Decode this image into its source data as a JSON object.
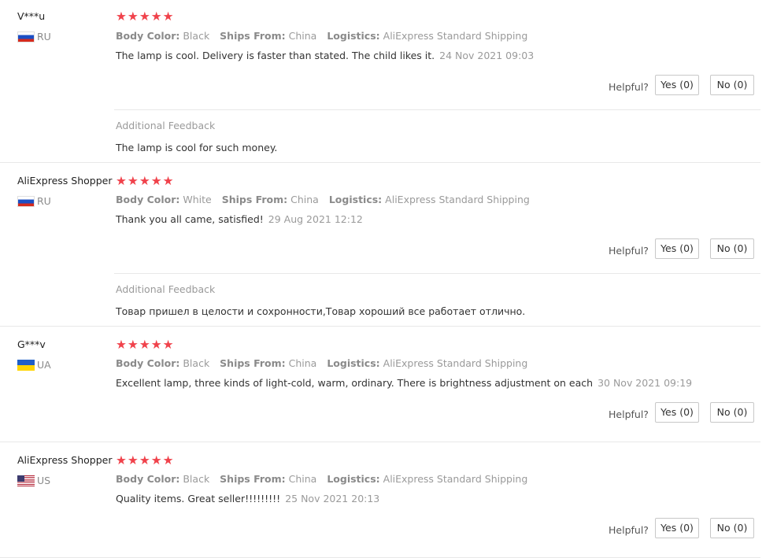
{
  "reviews": [
    {
      "user": "V***u",
      "country": "RU",
      "flag": "ru",
      "stars": 5,
      "attributes": {
        "color_label": "Body Color:",
        "color_value": "Black",
        "ships_label": "Ships From:",
        "ships_value": "China",
        "logistics_label": "Logistics:",
        "logistics_value": "AliExpress Standard Shipping"
      },
      "text": "The lamp is cool. Delivery is faster than stated. The child likes it.",
      "date": "24 Nov 2021 09:03",
      "helpful_label": "Helpful?",
      "yes_label": "Yes (0)",
      "no_label": "No (0)",
      "additional_feedback_title": "Additional Feedback",
      "additional_feedback_text": "The lamp is cool for such money."
    },
    {
      "user": "AliExpress Shopper",
      "country": "RU",
      "flag": "ru",
      "stars": 5,
      "attributes": {
        "color_label": "Body Color:",
        "color_value": "White",
        "ships_label": "Ships From:",
        "ships_value": "China",
        "logistics_label": "Logistics:",
        "logistics_value": "AliExpress Standard Shipping"
      },
      "text": "Thank you all came, satisfied!",
      "date": "29 Aug 2021 12:12",
      "helpful_label": "Helpful?",
      "yes_label": "Yes (0)",
      "no_label": "No (0)",
      "additional_feedback_title": "Additional Feedback",
      "additional_feedback_text": "Товар пришел в целости и сохронности,Товар хороший все работает отлично."
    },
    {
      "user": "G***v",
      "country": "UA",
      "flag": "ua",
      "stars": 5,
      "attributes": {
        "color_label": "Body Color:",
        "color_value": "Black",
        "ships_label": "Ships From:",
        "ships_value": "China",
        "logistics_label": "Logistics:",
        "logistics_value": "AliExpress Standard Shipping"
      },
      "text": "Excellent lamp, three kinds of light-cold, warm, ordinary. There is brightness adjustment on each",
      "date": "30 Nov 2021 09:19",
      "helpful_label": "Helpful?",
      "yes_label": "Yes (0)",
      "no_label": "No (0)"
    },
    {
      "user": "AliExpress Shopper",
      "country": "US",
      "flag": "us",
      "stars": 5,
      "attributes": {
        "color_label": "Body Color:",
        "color_value": "Black",
        "ships_label": "Ships From:",
        "ships_value": "China",
        "logistics_label": "Logistics:",
        "logistics_value": "AliExpress Standard Shipping"
      },
      "text": "Quality items. Great seller!!!!!!!!!",
      "date": "25 Nov 2021 20:13",
      "helpful_label": "Helpful?",
      "yes_label": "Yes (0)",
      "no_label": "No (0)"
    }
  ],
  "colors": {
    "star": "#f0424b",
    "muted": "#9a9a9a",
    "text": "#333333",
    "divider": "#e8e8e8"
  },
  "icons": {
    "star": "star-icon",
    "flag": "country-flag-icon"
  }
}
